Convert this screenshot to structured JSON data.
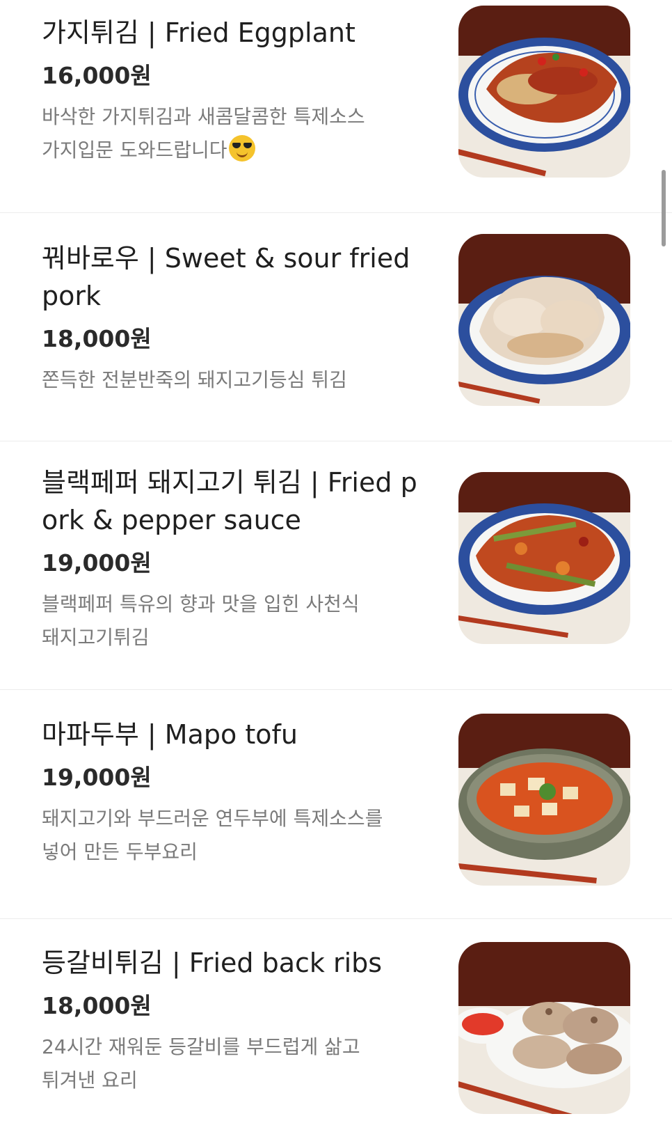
{
  "menu": {
    "items": [
      {
        "name": "가지튀김 | Fried Eggplant",
        "price": "16,000원",
        "desc_line1": "바삭한 가지튀김과 새콤달콤한 특제소스",
        "desc_line2": "가지입문 도와드랍니다",
        "desc_emoji": "smiling-face-with-sunglasses",
        "image_alt": "Fried eggplant with chili sauce on a blue-rimmed plate"
      },
      {
        "name": "꿔바로우 | Sweet & sour fried pork",
        "price": "18,000원",
        "desc_line1": "쫀득한 전분반죽의 돼지고기등심 튀김",
        "image_alt": "Crispy battered pork on a blue-rimmed plate"
      },
      {
        "name": "블랙페퍼 돼지고기 튀김 | Fried pork & pepper sauce",
        "price": "19,000원",
        "desc_line1": "블랙페퍼 특유의 향과 맛을 입힌 사천식",
        "desc_line2": "돼지고기튀김",
        "image_alt": "Fried pork with peppers on a blue-rimmed plate"
      },
      {
        "name": "마파두부 | Mapo tofu",
        "price": "19,000원",
        "desc_line1": "돼지고기와 부드러운 연두부에 특제소스를",
        "desc_line2": "넣어 만든 두부요리",
        "image_alt": "Mapo tofu in a clay pot"
      },
      {
        "name": "등갈비튀김 | Fried back ribs",
        "price": "18,000원",
        "desc_line1": "24시간 재워둔 등갈비를 부드럽게 삶고",
        "desc_line2": "튀겨낸 요리",
        "image_alt": "Fried back ribs with dipping sauce"
      }
    ]
  },
  "colors": {
    "text_primary": "#1f1f1f",
    "text_secondary": "#7a7a7a",
    "divider": "#ececec",
    "photo_backdrop": "#5a1e12",
    "plate_rim": "#2c4f9e"
  }
}
